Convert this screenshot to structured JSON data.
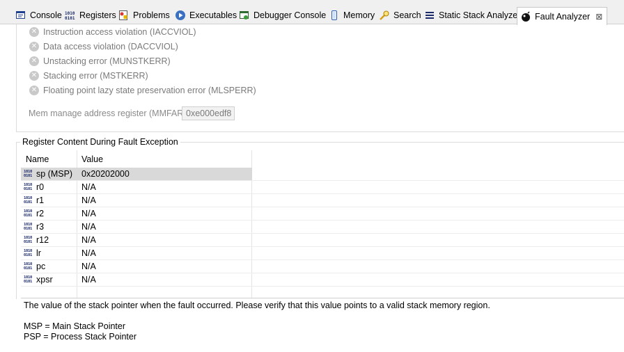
{
  "tabs": [
    {
      "label": "Console",
      "icon": "console-icon"
    },
    {
      "label": "Registers",
      "icon": "registers-icon"
    },
    {
      "label": "Problems",
      "icon": "problems-icon"
    },
    {
      "label": "Executables",
      "icon": "executables-icon"
    },
    {
      "label": "Debugger Console",
      "icon": "debugger-console-icon"
    },
    {
      "label": "Memory",
      "icon": "memory-icon"
    },
    {
      "label": "Search",
      "icon": "search-icon"
    },
    {
      "label": "Static Stack Analyzer",
      "icon": "stack-analyzer-icon"
    },
    {
      "label": "Fault Analyzer",
      "icon": "fault-analyzer-icon",
      "active": true
    }
  ],
  "close_glyph": "⊠",
  "faults": [
    "Instruction access violation (IACCVIOL)",
    "Data access violation (DACCVIOL)",
    "Unstacking error (MUNSTKERR)",
    "Stacking error (MSTKERR)",
    "Floating point lazy state preservation error (MLSPERR)"
  ],
  "mmfar": {
    "label": "Mem manage address register (MMFAR):",
    "value": "0xe000edf8"
  },
  "group": {
    "title": "Register Content During Fault Exception",
    "columns": {
      "name": "Name",
      "value": "Value"
    },
    "rows": [
      {
        "name": "sp (MSP)",
        "value": "0x20202000",
        "selected": true
      },
      {
        "name": "r0",
        "value": "N/A"
      },
      {
        "name": "r1",
        "value": "N/A"
      },
      {
        "name": "r2",
        "value": "N/A"
      },
      {
        "name": "r3",
        "value": "N/A"
      },
      {
        "name": "r12",
        "value": "N/A"
      },
      {
        "name": "lr",
        "value": "N/A"
      },
      {
        "name": "pc",
        "value": "N/A"
      },
      {
        "name": "xpsr",
        "value": "N/A"
      }
    ]
  },
  "description": {
    "main": "The value of the stack pointer when the fault occurred. Please verify that this value points to a valid stack memory region.",
    "msp": "MSP = Main Stack Pointer",
    "psp": "PSP = Process Stack Pointer"
  },
  "colors": {
    "selected_row": "#d9d9d9",
    "disabled_text": "#7a7a7a",
    "accent_icon": "#1a2a6a"
  }
}
